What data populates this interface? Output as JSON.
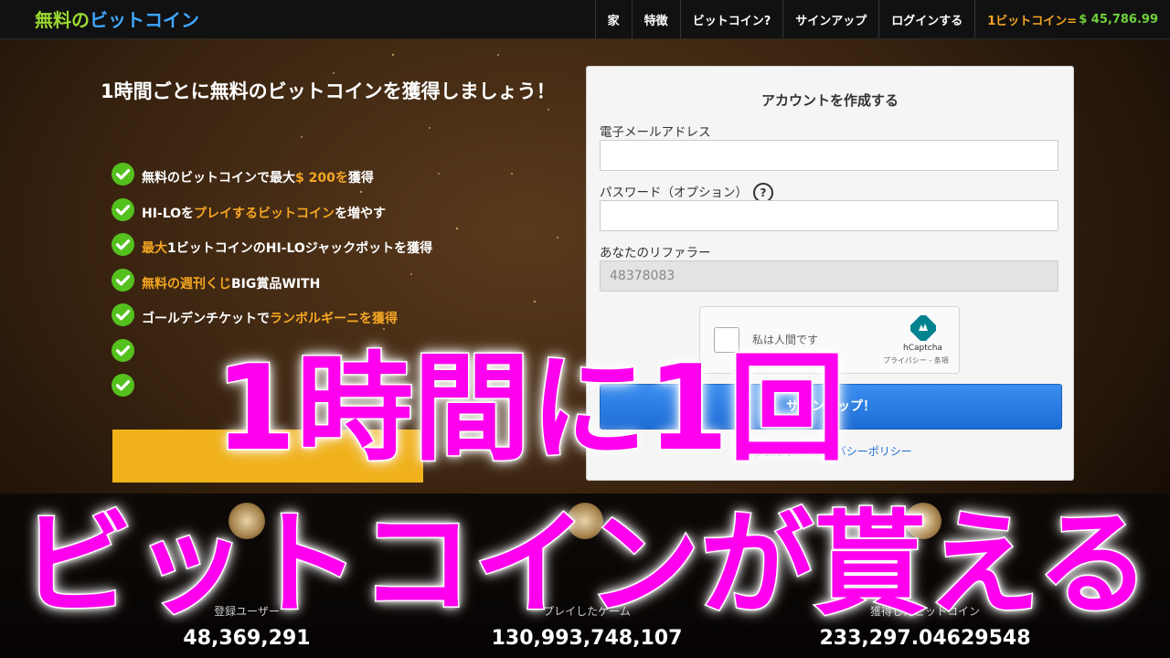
{
  "nav": {
    "brand_part1": "無料の",
    "brand_part2": "ビットコイン",
    "items": [
      "家",
      "特徴",
      "ビットコイン?",
      "サインアップ",
      "ログインする"
    ],
    "price_label": "1ビットコイン=",
    "price_value": "$ 45,786.99"
  },
  "hero": {
    "headline": "1時間ごとに無料のビットコインを獲得しましょう！",
    "features": [
      {
        "a": "無料のビットコインで最大",
        "b": "$ 200を",
        "c": "獲得"
      },
      {
        "a": "HI-LOを",
        "b": "プレイするビットコイン",
        "c": "を増やす"
      },
      {
        "a": "",
        "b": "最大",
        "c": "1ビットコインのHI-LOジャックポットを獲得"
      },
      {
        "a": "",
        "b": "無料の週刊くじ",
        "c": "BIG賞品WITH"
      },
      {
        "a": "ゴールデンチケットで",
        "b": "ランボルギーニを獲得",
        "c": ""
      },
      {
        "a": "",
        "b": "",
        "c": ""
      },
      {
        "a": "",
        "b": "",
        "c": ""
      }
    ]
  },
  "form": {
    "title": "アカウントを作成する",
    "email_label": "電子メールアドレス",
    "email_value": "",
    "password_label": "パスワード（オプション）",
    "help_glyph": "?",
    "referrer_label": "あなたのリファラー",
    "referrer_value": "48378083",
    "captcha_label": "私は人間です",
    "captcha_brand": "hCaptcha",
    "captcha_legal": "プライバシー - 条項",
    "signup_label": "サインアップ！",
    "terms_link": "利用規約",
    "privacy_link": "プライバシーポリシー"
  },
  "stats": [
    {
      "label": "登録ユーザー",
      "value": "48,369,291"
    },
    {
      "label": "プレイしたゲーム",
      "value": "130,993,748,107"
    },
    {
      "label": "獲得したビットコイン",
      "value": "233,297.04629548"
    }
  ],
  "overlay": {
    "line1": "1時間に1回",
    "line2": "ビットコインが貰える"
  },
  "colors": {
    "accent_orange": "#f5a623",
    "check_green": "#55c11f",
    "overlay_magenta": "#ff00ee",
    "button_blue": "#1b6bd6"
  }
}
